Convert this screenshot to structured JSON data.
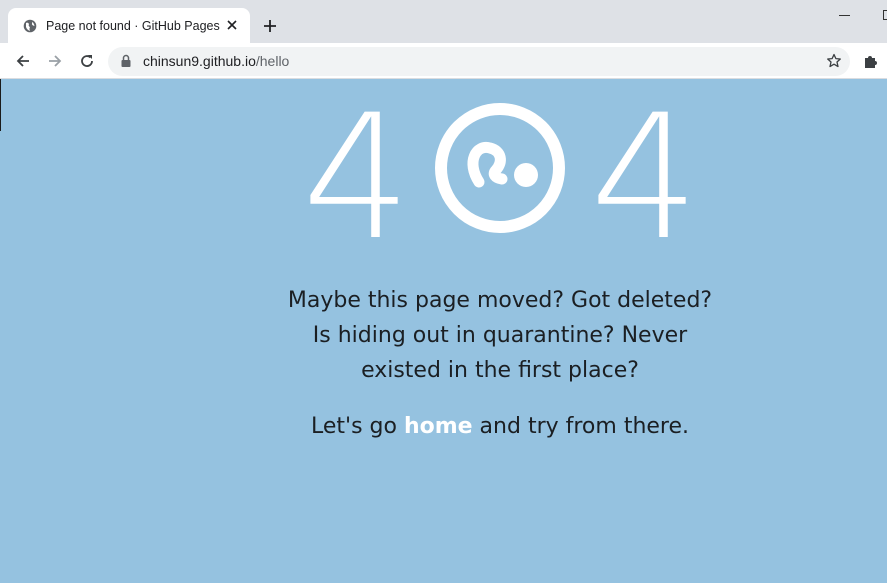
{
  "browser": {
    "tab": {
      "title": "Page not found · GitHub Pages",
      "favicon": "globe-icon"
    },
    "address": {
      "host": "chinsun9.github.io",
      "path": "/hello"
    }
  },
  "page": {
    "error_digit_left": "4",
    "error_digit_right": "4",
    "center_icon": "github-404-circle-icon",
    "message_lines": [
      "Maybe this page moved? Got deleted?",
      "Is hiding out in quarantine? Never",
      "existed in the first place?"
    ],
    "cta_before": "Let's go ",
    "cta_link": "home",
    "cta_after": " and try from there.",
    "background_color": "#95c2e0",
    "link_color": "#ffffff"
  }
}
